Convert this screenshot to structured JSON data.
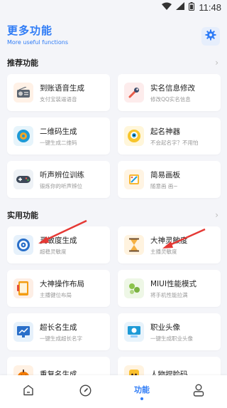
{
  "status": {
    "time": "11:48"
  },
  "header": {
    "title": "更多功能",
    "subtitle": "More useful functions"
  },
  "recommended": {
    "label": "推荐功能",
    "items": [
      {
        "name": "到账语音生成",
        "desc": "支付宝装逼语音",
        "icon": "radio-icon",
        "color": "#fff1e6"
      },
      {
        "name": "实名信息修改",
        "desc": "修改QQ实名信息",
        "icon": "wrench-icon",
        "color": "#fdecec"
      },
      {
        "name": "二维码生成",
        "desc": "一键生成二维码",
        "icon": "qrcode-icon",
        "color": "#e6f4fb"
      },
      {
        "name": "起名神器",
        "desc": "不会起名字？不用怕",
        "icon": "robot-icon",
        "color": "#fff6da"
      },
      {
        "name": "听声辨位训练",
        "desc": "锻炼你的听声辨位",
        "icon": "gamepad-icon",
        "color": "#eef2f6"
      },
      {
        "name": "简易画板",
        "desc": "随意画 画~",
        "icon": "palette-icon",
        "color": "#fff4e3"
      }
    ]
  },
  "practical": {
    "label": "实用功能",
    "items": [
      {
        "name": "灵敏度生成",
        "desc": "超稳灵敏度",
        "icon": "target-icon",
        "color": "#e6f1fb"
      },
      {
        "name": "大神灵敏度",
        "desc": "主播灵敏度",
        "icon": "hourglass-icon",
        "color": "#fff3df"
      },
      {
        "name": "大神操作布局",
        "desc": "主播键位布局",
        "icon": "phone-layout-icon",
        "color": "#fdeee5"
      },
      {
        "name": "MIUI性能模式",
        "desc": "将手机性能拉满",
        "icon": "speed-icon",
        "color": "#eef7e6"
      },
      {
        "name": "超长名生成",
        "desc": "一键生成超长名字",
        "icon": "chart-icon",
        "color": "#e6f1fb"
      },
      {
        "name": "职业头像",
        "desc": "一键生成职业头像",
        "icon": "monitor-icon",
        "color": "#e8f3fb"
      },
      {
        "name": "重复名生成",
        "desc": "",
        "icon": "pumpkin-icon",
        "color": "#fff1e3"
      },
      {
        "name": "人物捏脸码",
        "desc": "",
        "icon": "face-icon",
        "color": "#fff3e0"
      }
    ]
  },
  "nav": {
    "active_label": "功能"
  },
  "colors": {
    "accent": "#2f7cf6",
    "arrow": "#e53935"
  }
}
